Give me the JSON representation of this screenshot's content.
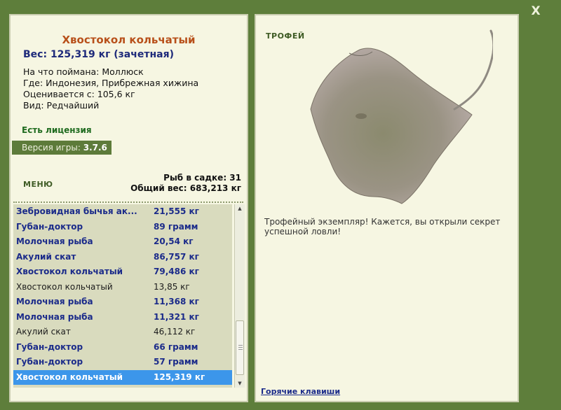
{
  "close_label": "X",
  "fish": {
    "title": "Хвостокол кольчатый",
    "weight": "Вес: 125,319 кг (зачетная)",
    "caught_on": "На что поймана: Моллюск",
    "location": "Где: Индонезия, Прибрежная хижина",
    "value": "Оценивается с: 105,6 кг",
    "rarity": "Вид: Редчайший"
  },
  "license": "Есть лицензия",
  "version": {
    "label": "Версия игры: ",
    "number": "3.7.6"
  },
  "menu_label": "МЕНЮ",
  "keep": {
    "count": "Рыб в садке: 31",
    "total": "Общий вес: 683,213 кг"
  },
  "fish_list": [
    {
      "name": "Зебровидная бычья ак...",
      "weight": "21,555 кг",
      "style": "bold"
    },
    {
      "name": "Губан-доктор",
      "weight": "89 грамм",
      "style": "bold"
    },
    {
      "name": "Молочная рыба",
      "weight": "20,54 кг",
      "style": "bold"
    },
    {
      "name": "Акулий скат",
      "weight": "86,757 кг",
      "style": "bold"
    },
    {
      "name": "Хвостокол кольчатый",
      "weight": "79,486 кг",
      "style": "bold"
    },
    {
      "name": "Хвостокол кольчатый",
      "weight": "13,85 кг",
      "style": "normal"
    },
    {
      "name": "Молочная рыба",
      "weight": "11,368 кг",
      "style": "bold"
    },
    {
      "name": "Молочная рыба",
      "weight": "11,321 кг",
      "style": "bold"
    },
    {
      "name": "Акулий скат",
      "weight": "46,112 кг",
      "style": "normal"
    },
    {
      "name": "Губан-доктор",
      "weight": "66 грамм",
      "style": "bold"
    },
    {
      "name": "Губан-доктор",
      "weight": "57 грамм",
      "style": "bold"
    },
    {
      "name": "Хвостокол кольчатый",
      "weight": "125,319 кг",
      "style": "selected"
    }
  ],
  "trophy_label": "ТРОФЕЙ",
  "description": "Трофейный экземпляр! Кажется, вы открыли секрет успешной ловли!",
  "hotkeys_label": "Горячие клавиши",
  "colors": {
    "frame": "#5e7e3b",
    "panel": "#f6f6e2",
    "title": "#b8501a",
    "bold_text": "#1b2b8a",
    "selection": "#3c96ea"
  }
}
